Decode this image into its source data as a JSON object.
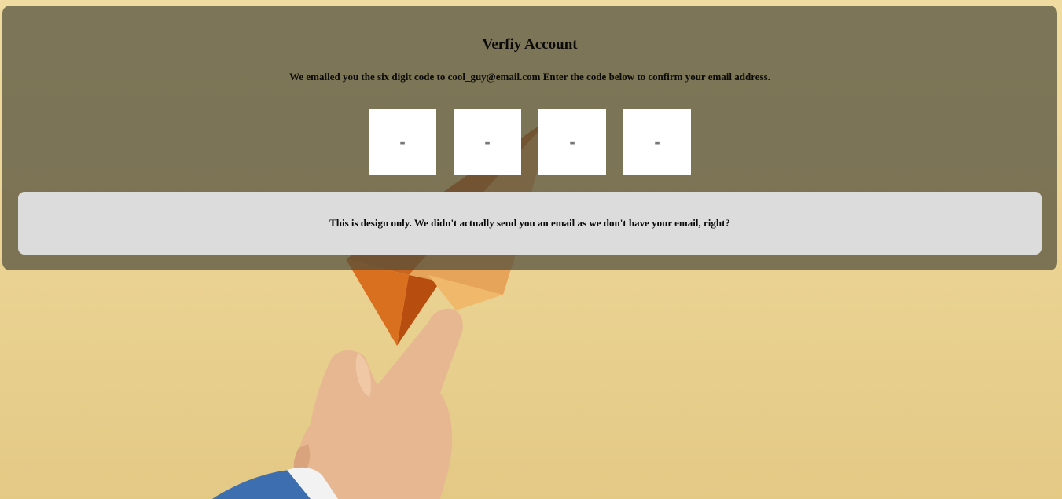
{
  "verify": {
    "title": "Verfiy Account",
    "message": "We emailed you the six digit code to cool_guy@email.com Enter the code below to confirm your email address.",
    "code_inputs": [
      {
        "placeholder": "-",
        "value": ""
      },
      {
        "placeholder": "-",
        "value": ""
      },
      {
        "placeholder": "-",
        "value": ""
      },
      {
        "placeholder": "-",
        "value": ""
      }
    ],
    "notice": "This is design only. We didn't actually send you an email as we don't have your email, right?"
  },
  "colors": {
    "background": "#ecd597",
    "overlay": "#504e3c",
    "notice_bg": "#dcdcdc",
    "input_bg": "#ffffff"
  }
}
